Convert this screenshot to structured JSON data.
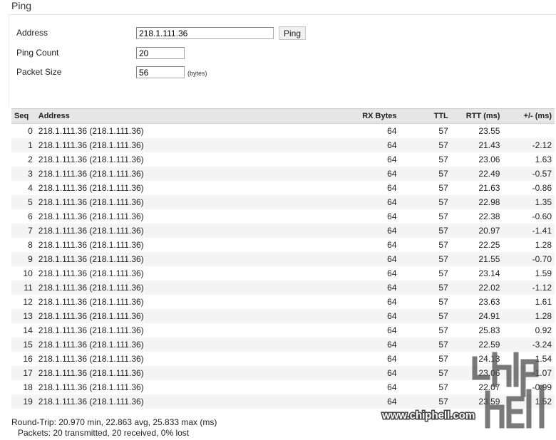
{
  "section_title": "Ping",
  "form": {
    "address_label": "Address",
    "address_value": "218.1.111.36",
    "ping_button": "Ping",
    "count_label": "Ping Count",
    "count_value": "20",
    "size_label": "Packet Size",
    "size_value": "56",
    "size_units": "(bytes)"
  },
  "table": {
    "headers": [
      "Seq",
      "Address",
      "RX Bytes",
      "TTL",
      "RTT (ms)",
      "+/- (ms)"
    ],
    "rows": [
      {
        "seq": "0",
        "address": "218.1.111.36 (218.1.111.36)",
        "rx": "64",
        "ttl": "57",
        "rtt": "23.55",
        "diff": ""
      },
      {
        "seq": "1",
        "address": "218.1.111.36 (218.1.111.36)",
        "rx": "64",
        "ttl": "57",
        "rtt": "21.43",
        "diff": "-2.12"
      },
      {
        "seq": "2",
        "address": "218.1.111.36 (218.1.111.36)",
        "rx": "64",
        "ttl": "57",
        "rtt": "23.06",
        "diff": "1.63"
      },
      {
        "seq": "3",
        "address": "218.1.111.36 (218.1.111.36)",
        "rx": "64",
        "ttl": "57",
        "rtt": "22.49",
        "diff": "-0.57"
      },
      {
        "seq": "4",
        "address": "218.1.111.36 (218.1.111.36)",
        "rx": "64",
        "ttl": "57",
        "rtt": "21.63",
        "diff": "-0.86"
      },
      {
        "seq": "5",
        "address": "218.1.111.36 (218.1.111.36)",
        "rx": "64",
        "ttl": "57",
        "rtt": "22.98",
        "diff": "1.35"
      },
      {
        "seq": "6",
        "address": "218.1.111.36 (218.1.111.36)",
        "rx": "64",
        "ttl": "57",
        "rtt": "22.38",
        "diff": "-0.60"
      },
      {
        "seq": "7",
        "address": "218.1.111.36 (218.1.111.36)",
        "rx": "64",
        "ttl": "57",
        "rtt": "20.97",
        "diff": "-1.41"
      },
      {
        "seq": "8",
        "address": "218.1.111.36 (218.1.111.36)",
        "rx": "64",
        "ttl": "57",
        "rtt": "22.25",
        "diff": "1.28"
      },
      {
        "seq": "9",
        "address": "218.1.111.36 (218.1.111.36)",
        "rx": "64",
        "ttl": "57",
        "rtt": "21.55",
        "diff": "-0.70"
      },
      {
        "seq": "10",
        "address": "218.1.111.36 (218.1.111.36)",
        "rx": "64",
        "ttl": "57",
        "rtt": "23.14",
        "diff": "1.59"
      },
      {
        "seq": "11",
        "address": "218.1.111.36 (218.1.111.36)",
        "rx": "64",
        "ttl": "57",
        "rtt": "22.02",
        "diff": "-1.12"
      },
      {
        "seq": "12",
        "address": "218.1.111.36 (218.1.111.36)",
        "rx": "64",
        "ttl": "57",
        "rtt": "23.63",
        "diff": "1.61"
      },
      {
        "seq": "13",
        "address": "218.1.111.36 (218.1.111.36)",
        "rx": "64",
        "ttl": "57",
        "rtt": "24.91",
        "diff": "1.28"
      },
      {
        "seq": "14",
        "address": "218.1.111.36 (218.1.111.36)",
        "rx": "64",
        "ttl": "57",
        "rtt": "25.83",
        "diff": "0.92"
      },
      {
        "seq": "15",
        "address": "218.1.111.36 (218.1.111.36)",
        "rx": "64",
        "ttl": "57",
        "rtt": "22.59",
        "diff": "-3.24"
      },
      {
        "seq": "16",
        "address": "218.1.111.36 (218.1.111.36)",
        "rx": "64",
        "ttl": "57",
        "rtt": "24.13",
        "diff": "1.54"
      },
      {
        "seq": "17",
        "address": "218.1.111.36 (218.1.111.36)",
        "rx": "64",
        "ttl": "57",
        "rtt": "23.06",
        "diff": "-1.07"
      },
      {
        "seq": "18",
        "address": "218.1.111.36 (218.1.111.36)",
        "rx": "64",
        "ttl": "57",
        "rtt": "22.07",
        "diff": "-0.99"
      },
      {
        "seq": "19",
        "address": "218.1.111.36 (218.1.111.36)",
        "rx": "64",
        "ttl": "57",
        "rtt": "23.59",
        "diff": "1.52"
      }
    ]
  },
  "summary": {
    "round_trip": "Round-Trip: 20.970 min, 22.863 avg, 25.833 max (ms)",
    "packets": "Packets: 20 transmitted, 20 received, 0% lost"
  },
  "watermark": {
    "site_text": "www.chiphell.com",
    "logo_text": "chip hell"
  }
}
